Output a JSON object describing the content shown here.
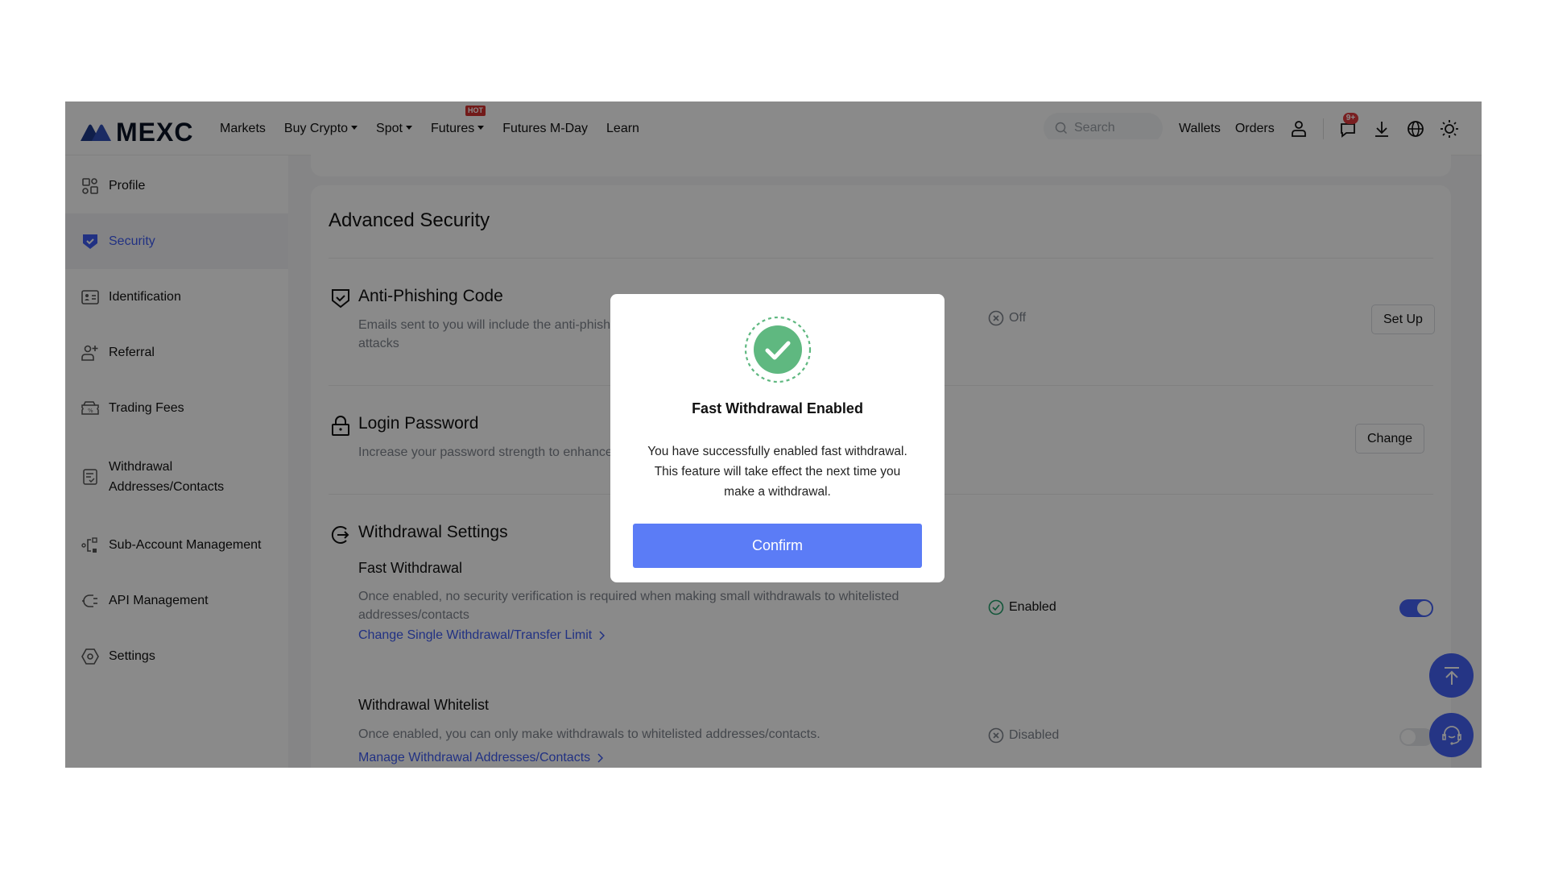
{
  "header": {
    "logo_text": "MEXC",
    "nav": [
      {
        "label": "Markets",
        "has_caret": false
      },
      {
        "label": "Buy Crypto",
        "has_caret": true
      },
      {
        "label": "Spot",
        "has_caret": true
      },
      {
        "label": "Futures",
        "has_caret": true,
        "badge": "HOT"
      },
      {
        "label": "Futures M-Day",
        "has_caret": false
      },
      {
        "label": "Learn",
        "has_caret": false
      }
    ],
    "search_placeholder": "Search",
    "wallets_label": "Wallets",
    "orders_label": "Orders",
    "notification_count": "9+",
    "icons": [
      "user-icon",
      "message-icon",
      "download-icon",
      "globe-icon",
      "theme-sun-icon"
    ]
  },
  "sidebar": {
    "active": "Security",
    "items": [
      {
        "label": "Profile",
        "icon": "profile-grid-icon"
      },
      {
        "label": "Security",
        "icon": "shield-check-icon"
      },
      {
        "label": "Identification",
        "icon": "id-card-icon"
      },
      {
        "label": "Referral",
        "icon": "user-plus-icon"
      },
      {
        "label": "Trading Fees",
        "icon": "fee-ticket-icon"
      },
      {
        "label": "Withdrawal Addresses/Contacts",
        "icon": "address-list-icon"
      },
      {
        "label": "Sub-Account Management",
        "icon": "sub-account-icon"
      },
      {
        "label": "API Management",
        "icon": "plug-icon"
      },
      {
        "label": "Settings",
        "icon": "settings-hex-icon"
      }
    ]
  },
  "main": {
    "title": "Advanced Security",
    "anti_phishing": {
      "title": "Anti-Phishing Code",
      "description_visible": "Emails sent to you will include the anti-phish",
      "description_line2": "attacks",
      "status": "Off",
      "button": "Set Up"
    },
    "login_password": {
      "title": "Login Password",
      "description_visible": "Increase your password strength to enhance",
      "button": "Change"
    },
    "withdrawal_settings": {
      "title": "Withdrawal Settings",
      "fast_withdrawal": {
        "title": "Fast Withdrawal",
        "description": "Once enabled, no security verification is required when making small withdrawals to whitelisted addresses/contacts",
        "link": "Change Single Withdrawal/Transfer Limit",
        "status": "Enabled",
        "toggle_on": true
      },
      "whitelist": {
        "title": "Withdrawal Whitelist",
        "description": "Once enabled, you can only make withdrawals to whitelisted addresses/contacts.",
        "link": "Manage Withdrawal Addresses/Contacts",
        "status": "Disabled",
        "toggle_on": false
      }
    }
  },
  "fabs": [
    "back-to-top-icon",
    "customer-support-icon"
  ],
  "modal": {
    "title": "Fast Withdrawal Enabled",
    "body_line1": "You have successfully enabled fast withdrawal.",
    "body_line2": "This feature will take effect the next time you",
    "body_line3": "make a withdrawal.",
    "confirm_label": "Confirm",
    "success_color": "#5fb880",
    "button_color": "#5b7cf6"
  },
  "colors": {
    "accent": "#3e5bf2",
    "success": "#22a06b",
    "hot_badge": "#d3312f"
  }
}
